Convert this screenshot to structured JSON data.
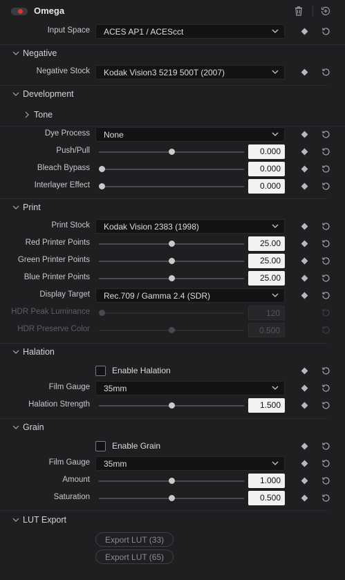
{
  "header": {
    "title": "Omega",
    "toggle_on": true,
    "icons": [
      "trash-icon",
      "history-add-icon"
    ]
  },
  "input_space": {
    "label": "Input Space",
    "value": "ACES AP1 / ACEScct"
  },
  "sections": {
    "negative": "Negative",
    "development": "Development",
    "tone": "Tone",
    "print": "Print",
    "halation": "Halation",
    "grain": "Grain",
    "lut_export": "LUT Export"
  },
  "negative": {
    "stock_label": "Negative Stock",
    "stock_value": "Kodak Vision3 5219 500T (2007)"
  },
  "development": {
    "dye_process": {
      "label": "Dye Process",
      "value": "None"
    },
    "push_pull": {
      "label": "Push/Pull",
      "value": "0.000",
      "level": 0.5
    },
    "bleach_bypass": {
      "label": "Bleach Bypass",
      "value": "0.000",
      "level": 0.0
    },
    "interlayer_effect": {
      "label": "Interlayer Effect",
      "value": "0.000",
      "level": 0.0
    }
  },
  "print": {
    "print_stock": {
      "label": "Print Stock",
      "value": "Kodak Vision 2383 (1998)"
    },
    "red_points": {
      "label": "Red Printer Points",
      "value": "25.00",
      "level": 0.5
    },
    "green_points": {
      "label": "Green Printer Points",
      "value": "25.00",
      "level": 0.5
    },
    "blue_points": {
      "label": "Blue Printer Points",
      "value": "25.00",
      "level": 0.5
    },
    "display_target": {
      "label": "Display Target",
      "value": "Rec.709 / Gamma 2.4 (SDR)"
    },
    "hdr_peak": {
      "label": "HDR Peak Luminance",
      "value": "120",
      "level": 0.0,
      "enabled": false
    },
    "hdr_preserve": {
      "label": "HDR Preserve Color",
      "value": "0.500",
      "level": 0.5,
      "enabled": false
    }
  },
  "halation": {
    "enable_label": "Enable Halation",
    "enabled": false,
    "film_gauge": {
      "label": "Film Gauge",
      "value": "35mm"
    },
    "strength": {
      "label": "Halation Strength",
      "value": "1.500",
      "level": 0.5
    }
  },
  "grain": {
    "enable_label": "Enable Grain",
    "enabled": false,
    "film_gauge": {
      "label": "Film Gauge",
      "value": "35mm"
    },
    "amount": {
      "label": "Amount",
      "value": "1.000",
      "level": 0.5
    },
    "saturation": {
      "label": "Saturation",
      "value": "0.500",
      "level": 0.5
    }
  },
  "lut_export": {
    "btn_33": "Export LUT (33)",
    "btn_65": "Export LUT (65)"
  },
  "colors": {
    "accent_red": "#e0322f",
    "panel_bg": "#1f1f22",
    "field_bg": "#131315",
    "numbox_bg": "#f2f2f4"
  }
}
